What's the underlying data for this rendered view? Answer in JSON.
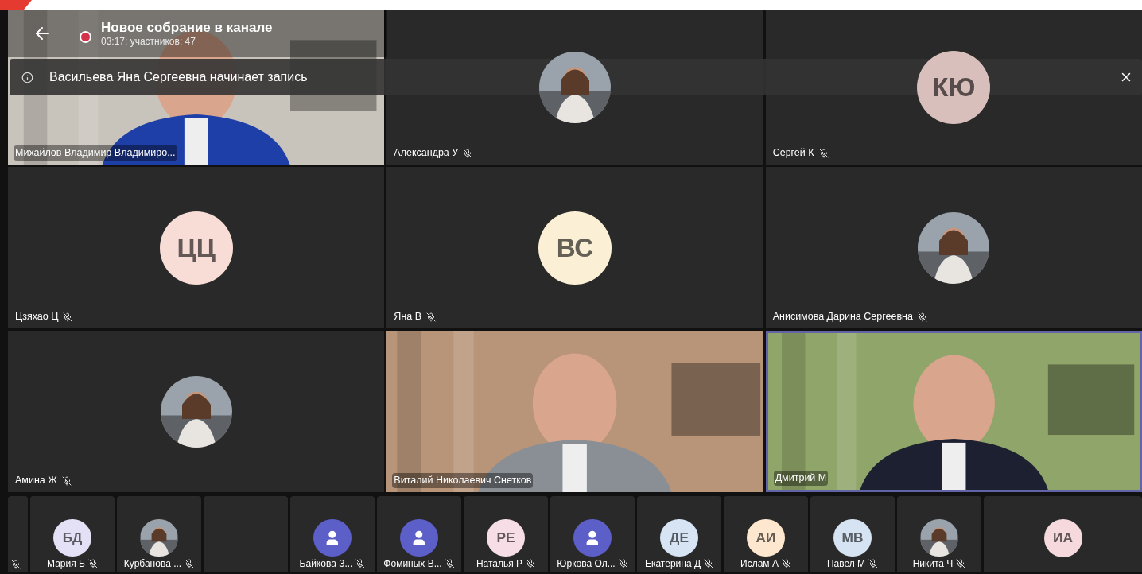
{
  "meeting": {
    "title": "Новое собрание в канале",
    "subtitle": "03:17; участников: 47",
    "recording": true
  },
  "notification": {
    "text": "Васильева Яна Сергеевна начинает запись"
  },
  "tiles": [
    {
      "kind": "video",
      "name": "Михайлов Владимир Владимиро...",
      "muted": false,
      "speaking": false
    },
    {
      "name": "Александра У",
      "muted": true,
      "speaking": false
    },
    {
      "kind": "initials",
      "initials": "КЮ",
      "color": "#d9bfbb",
      "name": "Сергей К",
      "muted": true,
      "speaking": false
    },
    {
      "kind": "initials",
      "initials": "ЦЦ",
      "color": "#f8dcd6",
      "name": "Цзяхао Ц",
      "muted": true,
      "speaking": false
    },
    {
      "kind": "initials",
      "initials": "ВС",
      "color": "#fbefd6",
      "name": "Яна В",
      "muted": true,
      "speaking": false
    },
    {
      "name": "Анисимова Дарина Сергеевна",
      "muted": true,
      "speaking": false
    },
    {
      "name": "Амина Ж",
      "muted": true,
      "speaking": false
    },
    {
      "kind": "video",
      "name": "Виталий Николаевич Снетков",
      "muted": false,
      "speaking": false
    },
    {
      "kind": "video",
      "name": "Дмитрий М",
      "muted": false,
      "speaking": true
    }
  ],
  "strip": [
    {
      "kind": "blank",
      "muted": true
    },
    {
      "kind": "initials",
      "initials": "БД",
      "color": "#e4e0f5",
      "name": "Мария Б",
      "muted": true
    },
    {
      "name": "Курбанова ...",
      "muted": true
    },
    {
      "kind": "blank"
    },
    {
      "kind": "person",
      "name": "Байкова З...",
      "muted": true
    },
    {
      "kind": "person",
      "name": "Фоминых В...",
      "muted": true
    },
    {
      "kind": "initials",
      "initials": "РЕ",
      "color": "#f6dde6",
      "name": "Наталья Р",
      "muted": true
    },
    {
      "kind": "person",
      "name": "Юркова Ол...",
      "muted": true
    },
    {
      "kind": "initials",
      "initials": "ДЕ",
      "color": "#d6e4f4",
      "name": "Екатерина Д",
      "muted": true
    },
    {
      "kind": "initials",
      "initials": "АИ",
      "color": "#fde8cf",
      "name": "Ислам А",
      "muted": true
    },
    {
      "kind": "initials",
      "initials": "МВ",
      "color": "#d5e3f3",
      "name": "Павел М",
      "muted": true
    },
    {
      "name": "Никита Ч",
      "muted": true
    },
    {
      "kind": "initials",
      "initials": "ИА",
      "color": "#f5d9dc"
    }
  ]
}
